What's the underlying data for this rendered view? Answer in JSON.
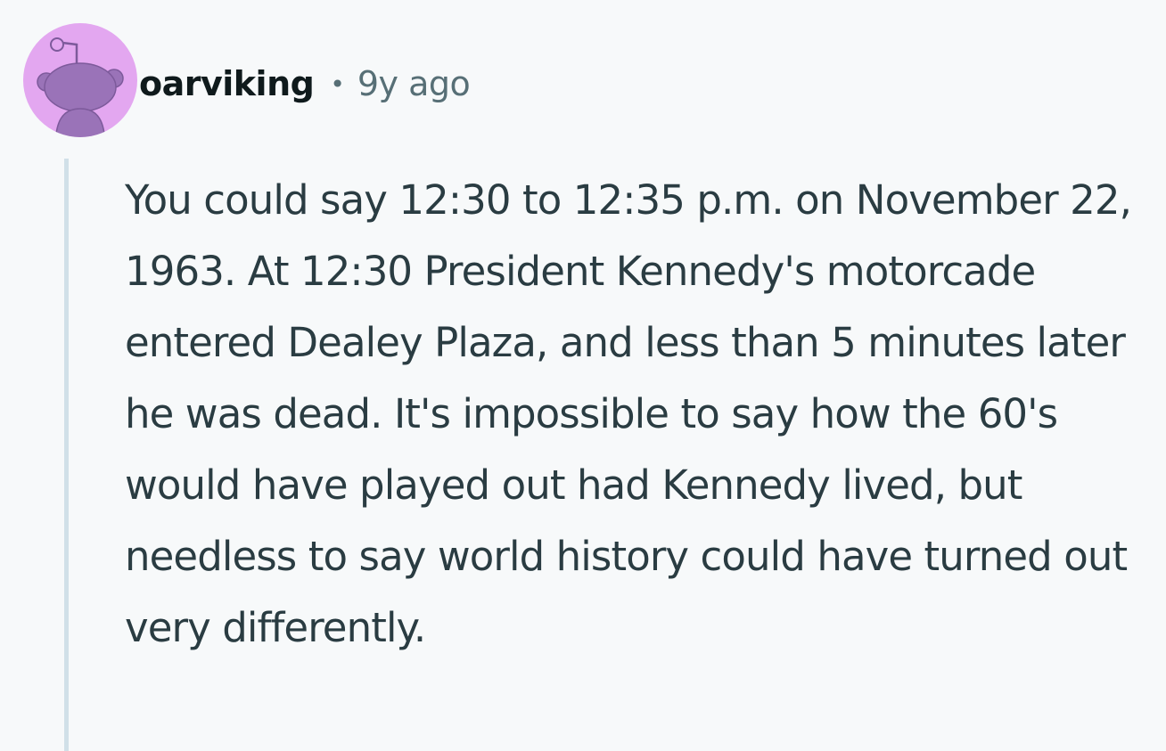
{
  "comment": {
    "avatar": {
      "icon": "snoo-avatar-icon",
      "background_color": "#e3a7f0",
      "figure_color": "#9a73b8"
    },
    "author": "oarviking",
    "separator": "•",
    "timestamp": "9y ago",
    "body": "You could say 12:30 to 12:35 p.m. on November 22, 1963. At 12:30 President Kennedy's motorcade entered Dealey Plaza, and less than 5 minutes later he was dead. It's impossible to say how the 60's would have played out had Kennedy lived, but needless to say world history could have turned out very differently."
  }
}
